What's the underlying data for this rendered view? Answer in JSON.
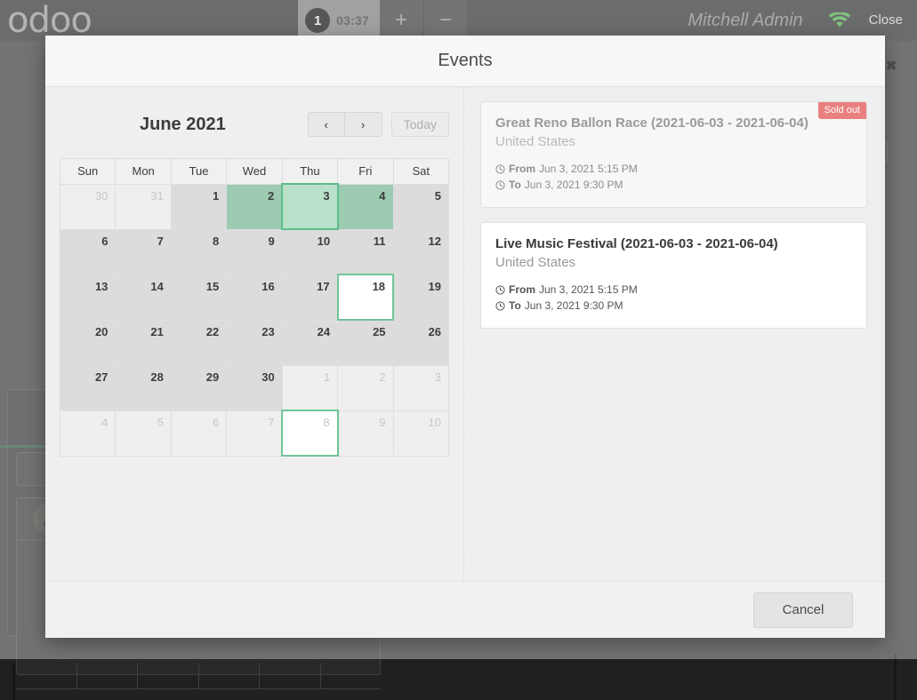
{
  "pos": {
    "logo": "odoo",
    "order": {
      "badge": "1",
      "timer": "03:37"
    },
    "buttons": {
      "add": "+",
      "remove": "−"
    },
    "user": "Mitchell Admin",
    "wifi_icon": "wifi-icon",
    "wifi_color": "#3fa63f",
    "close": "Close"
  },
  "overlay": {
    "close_icon": "✖"
  },
  "modal": {
    "title": "Events",
    "cancel_label": "Cancel"
  },
  "calendar": {
    "title": "June 2021",
    "prev_label": "‹",
    "next_label": "›",
    "today_label": "Today",
    "weekdays": [
      "Sun",
      "Mon",
      "Tue",
      "Wed",
      "Thu",
      "Fri",
      "Sat"
    ],
    "weeks": [
      [
        {
          "day": "30",
          "state": "other"
        },
        {
          "day": "31",
          "state": "other"
        },
        {
          "day": "1",
          "state": "normal"
        },
        {
          "day": "2",
          "state": "avail"
        },
        {
          "day": "3",
          "state": "sel"
        },
        {
          "day": "4",
          "state": "avail"
        },
        {
          "day": "5",
          "state": "normal"
        }
      ],
      [
        {
          "day": "6",
          "state": "normal"
        },
        {
          "day": "7",
          "state": "normal"
        },
        {
          "day": "8",
          "state": "normal"
        },
        {
          "day": "9",
          "state": "normal"
        },
        {
          "day": "10",
          "state": "normal"
        },
        {
          "day": "11",
          "state": "normal"
        },
        {
          "day": "12",
          "state": "normal"
        }
      ],
      [
        {
          "day": "13",
          "state": "normal"
        },
        {
          "day": "14",
          "state": "normal"
        },
        {
          "day": "15",
          "state": "normal"
        },
        {
          "day": "16",
          "state": "normal"
        },
        {
          "day": "17",
          "state": "normal"
        },
        {
          "day": "18",
          "state": "today"
        },
        {
          "day": "19",
          "state": "normal"
        }
      ],
      [
        {
          "day": "20",
          "state": "normal"
        },
        {
          "day": "21",
          "state": "normal"
        },
        {
          "day": "22",
          "state": "normal"
        },
        {
          "day": "23",
          "state": "normal"
        },
        {
          "day": "24",
          "state": "normal"
        },
        {
          "day": "25",
          "state": "normal"
        },
        {
          "day": "26",
          "state": "normal"
        }
      ],
      [
        {
          "day": "27",
          "state": "normal"
        },
        {
          "day": "28",
          "state": "normal"
        },
        {
          "day": "29",
          "state": "normal"
        },
        {
          "day": "30",
          "state": "normal"
        },
        {
          "day": "1",
          "state": "other"
        },
        {
          "day": "2",
          "state": "other"
        },
        {
          "day": "3",
          "state": "other"
        }
      ],
      [
        {
          "day": "4",
          "state": "other"
        },
        {
          "day": "5",
          "state": "other"
        },
        {
          "day": "6",
          "state": "other"
        },
        {
          "day": "7",
          "state": "other"
        },
        {
          "day": "8",
          "state": "today other"
        },
        {
          "day": "9",
          "state": "other"
        },
        {
          "day": "10",
          "state": "other"
        }
      ]
    ]
  },
  "events": {
    "from_label": "From",
    "to_label": "To",
    "items": [
      {
        "name": "Great Reno Ballon Race (2021-06-03 - 2021-06-04)",
        "place": "United States",
        "from": "Jun 3, 2021 5:15 PM",
        "to": "Jun 3, 2021 9:30 PM",
        "sold_out": true,
        "badge": "Sold out"
      },
      {
        "name": "Live Music Festival (2021-06-03 - 2021-06-04)",
        "place": "United States",
        "from": "Jun 3, 2021 5:15 PM",
        "to": "Jun 3, 2021 9:30 PM",
        "sold_out": false,
        "badge": ""
      }
    ]
  },
  "colors": {
    "available_day": "#9ccbb2",
    "selected_day": "#b9e0c9",
    "today_border": "#71c498",
    "sold_out_badge": "#e98080"
  }
}
